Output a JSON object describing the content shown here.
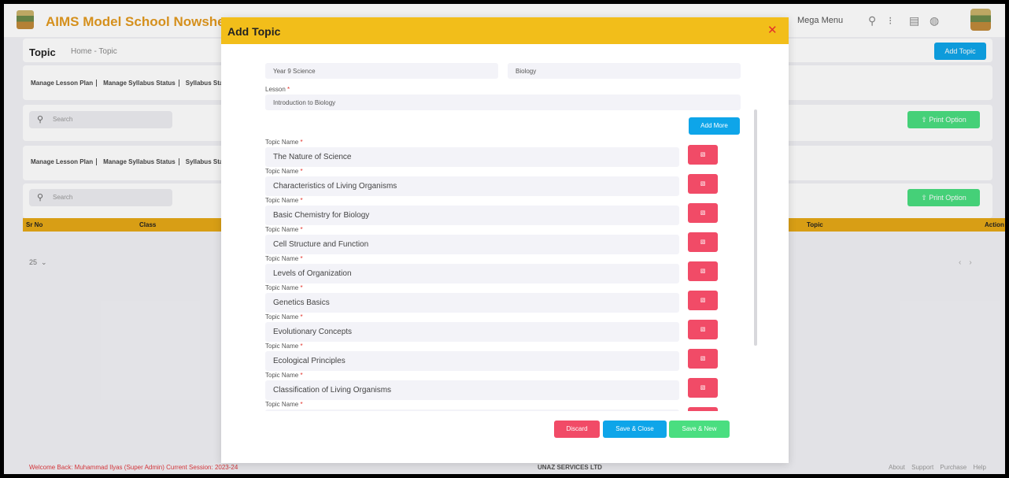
{
  "app": {
    "brand": "AIMS Model School Nowshera",
    "mega_menu": "Mega Menu"
  },
  "page": {
    "title": "Topic",
    "breadcrumb": "Home - Topic",
    "add_topic_button": "Add Topic",
    "print_option": "Print Option",
    "search_placeholder": "Search",
    "tabs": [
      "Manage Lesson Plan",
      "Manage Syllabus Status",
      "Syllabus Stat"
    ],
    "table_headers": {
      "sr_no": "Sr No",
      "class": "Class",
      "topic": "Topic",
      "action": "Action"
    },
    "page_size": "25"
  },
  "footer": {
    "welcome": "Welcome Back: Muhammad Ilyas (Super Admin)  Current Session: 2023-24",
    "copyright": "UNAZ SERVICES LTD",
    "links": [
      "About",
      "Support",
      "Purchase",
      "Help"
    ]
  },
  "modal": {
    "title": "Add Topic",
    "class_value": "Year 9 Science",
    "subject_value": "Biology",
    "lesson_label": "Lesson",
    "lesson_value": "Introduction to Biology",
    "add_more": "Add More",
    "topic_label": "Topic Name",
    "topics": [
      "The Nature of Science",
      "Characteristics of Living Organisms",
      "Basic Chemistry for Biology",
      "Cell Structure and Function",
      "Levels of Organization",
      "Genetics Basics",
      "Evolutionary Concepts",
      "Ecological Principles",
      "Classification of Living Organisms",
      ""
    ],
    "actions": {
      "discard": "Discard",
      "save_close": "Save & Close",
      "save_new": "Save & New"
    }
  },
  "colors": {
    "brand": "#e39a1f",
    "header_yellow": "#f2be1a",
    "primary_blue": "#0ea5e9",
    "danger_pink": "#f14b67",
    "success_green": "#4ade80"
  }
}
